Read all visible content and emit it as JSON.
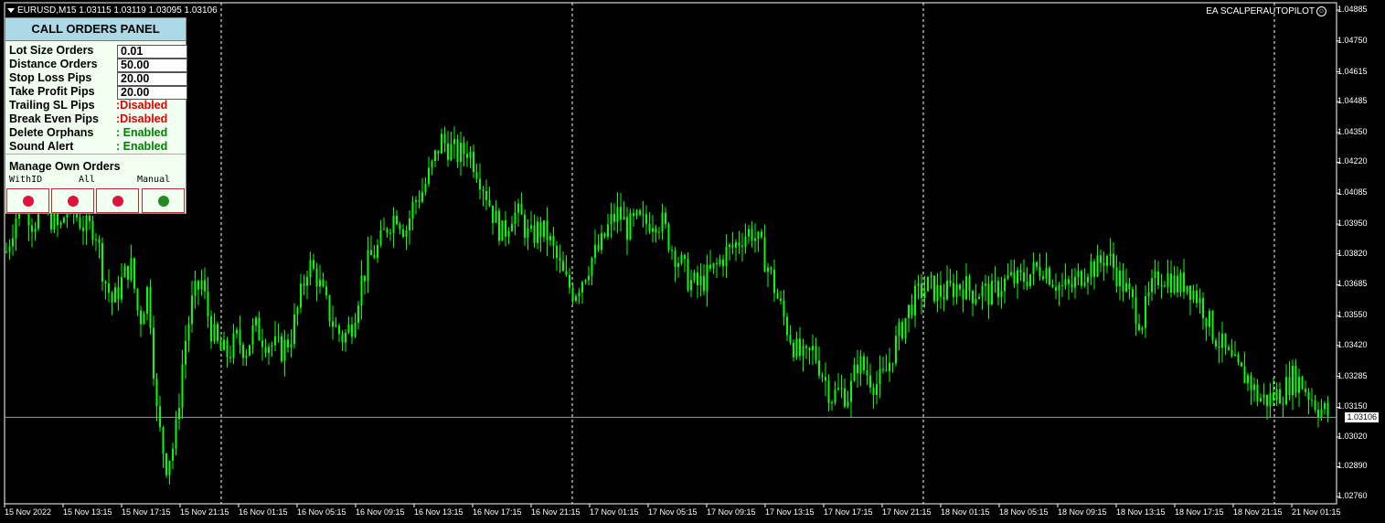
{
  "chart": {
    "symbol_line": "EURUSD,M15  1.03115 1.03119 1.03095 1.03106",
    "ea_label": "EA SCALPERAUTOPILOT",
    "current_price": "1.03106",
    "colors": {
      "background": "#000000",
      "candles": "#00ff00",
      "grid": "#ffffff",
      "text": "#ffffff"
    },
    "price_labels": [
      "1.04885",
      "1.04750",
      "1.04615",
      "1.04485",
      "1.04350",
      "1.04220",
      "1.04085",
      "1.03950",
      "1.03820",
      "1.03685",
      "1.03550",
      "1.03420",
      "1.03285",
      "1.03150",
      "1.03020",
      "1.02890",
      "1.02760"
    ],
    "time_labels": [
      "15 Nov 2022",
      "15 Nov 13:15",
      "15 Nov 17:15",
      "15 Nov 21:15",
      "16 Nov 01:15",
      "16 Nov 05:15",
      "16 Nov 09:15",
      "16 Nov 13:15",
      "16 Nov 17:15",
      "16 Nov 21:15",
      "17 Nov 01:15",
      "17 Nov 05:15",
      "17 Nov 09:15",
      "17 Nov 13:15",
      "17 Nov 17:15",
      "17 Nov 21:15",
      "18 Nov 01:15",
      "18 Nov 05:15",
      "18 Nov 09:15",
      "18 Nov 13:15",
      "18 Nov 17:15",
      "18 Nov 21:15",
      "21 Nov 01:15"
    ],
    "close_path": [
      1.0383,
      1.0398,
      1.0405,
      1.0395,
      1.0402,
      1.0398,
      1.0392,
      1.0405,
      1.0398,
      1.0393,
      1.0394,
      1.0372,
      1.036,
      1.037,
      1.0378,
      1.0352,
      1.0368,
      1.031,
      1.029,
      1.03,
      1.034,
      1.0362,
      1.037,
      1.035,
      1.034,
      1.0338,
      1.0345,
      1.034,
      1.035,
      1.0345,
      1.0342,
      1.034,
      1.0345,
      1.036,
      1.0378,
      1.0372,
      1.036,
      1.035,
      1.0345,
      1.0352,
      1.037,
      1.038,
      1.0385,
      1.0395,
      1.04,
      1.0392,
      1.0405,
      1.041,
      1.042,
      1.0432,
      1.0428,
      1.0425,
      1.0428,
      1.042,
      1.041,
      1.0398,
      1.039,
      1.04,
      1.0398,
      1.0388,
      1.0393,
      1.039,
      1.038,
      1.037,
      1.0365,
      1.0372,
      1.038,
      1.0385,
      1.0395,
      1.04,
      1.0393,
      1.0396,
      1.0395,
      1.0398,
      1.0395,
      1.0385,
      1.0378,
      1.037,
      1.0368,
      1.0372,
      1.0376,
      1.0382,
      1.0385,
      1.039,
      1.0392,
      1.0385,
      1.0375,
      1.0362,
      1.035,
      1.034,
      1.0335,
      1.034,
      1.033,
      1.032,
      1.0322,
      1.032,
      1.0335,
      1.033,
      1.0325,
      1.0328,
      1.034,
      1.035,
      1.036,
      1.0365,
      1.0368,
      1.0365,
      1.0365,
      1.0368,
      1.0368,
      1.0365,
      1.0366,
      1.0364,
      1.0368,
      1.0371,
      1.037,
      1.0372,
      1.0375,
      1.0377,
      1.0371,
      1.0367,
      1.0367,
      1.0372,
      1.0377,
      1.0376,
      1.0382,
      1.0375,
      1.0368,
      1.036,
      1.0352,
      1.0365,
      1.0373,
      1.0372,
      1.0368,
      1.037,
      1.0365,
      1.0358,
      1.0348,
      1.0342,
      1.0335,
      1.033,
      1.0328,
      1.032,
      1.0318,
      1.032,
      1.0322,
      1.0328,
      1.0326,
      1.032,
      1.0315,
      1.0312
    ]
  },
  "panel": {
    "title": "CALL ORDERS PANEL",
    "fields": [
      {
        "label": "Lot Size Orders",
        "value": "0.01"
      },
      {
        "label": "Distance Orders",
        "value": "50.00"
      },
      {
        "label": "Stop Loss Pips",
        "value": "20.00"
      },
      {
        "label": "Take Profit Pips",
        "value": "20.00"
      }
    ],
    "statuses": [
      {
        "label": "Trailing SL Pips",
        "value": ":Disabled",
        "color": "#e30000"
      },
      {
        "label": "Break Even Pips",
        "value": ":Disabled",
        "color": "#e30000"
      },
      {
        "label": "Delete Orphans",
        "value": ": Enabled",
        "color": "#008000"
      },
      {
        "label": "Sound Alert",
        "value": ": Enabled",
        "color": "#008000"
      }
    ],
    "manage_label": "Manage  Own Orders",
    "sub_labels": [
      "WithID",
      "All",
      "Manual"
    ],
    "buttons": [
      {
        "name": "withid-toggle",
        "color": "#dc143c"
      },
      {
        "name": "all-toggle",
        "color": "#dc143c"
      },
      {
        "name": "extra-toggle",
        "color": "#dc143c"
      },
      {
        "name": "manual-toggle",
        "color": "#228b22"
      }
    ]
  }
}
